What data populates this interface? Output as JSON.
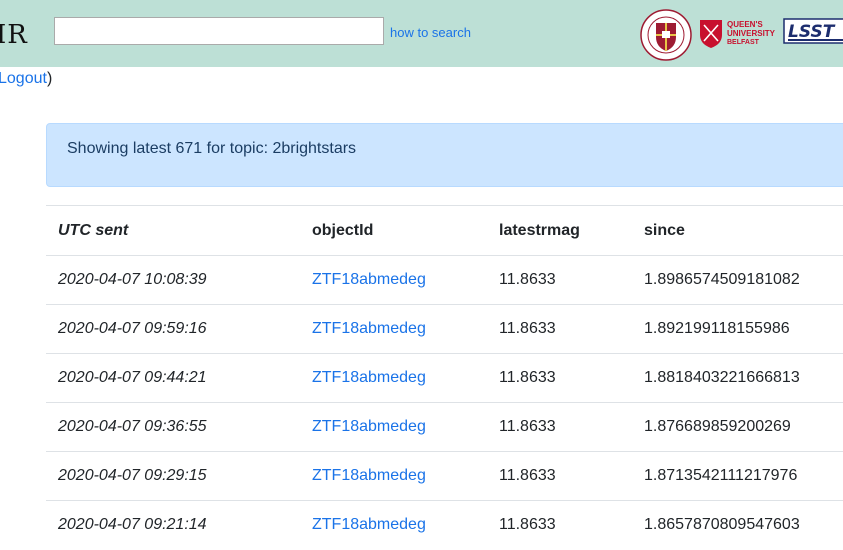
{
  "header": {
    "logo_text": "IR",
    "search": {
      "value": "",
      "placeholder": ""
    },
    "how_to_search": "how to search",
    "logos": [
      "university-of-edinburgh-logo",
      "queens-university-belfast-logo",
      "lsst-logo"
    ],
    "qub_text": [
      "QUEEN'S",
      "UNIVERSITY",
      "BELFAST"
    ],
    "lsst_text": "LSST",
    "uoe_text": "THE UNIVERSITY OF EDINBURGH"
  },
  "logout": {
    "link": "Logout",
    "suffix": ")"
  },
  "alert": {
    "text": "Showing latest 671 for topic: 2brightstars"
  },
  "table": {
    "headers": [
      "UTC sent",
      "objectId",
      "latestrmag",
      "since"
    ],
    "rows": [
      [
        "2020-04-07 10:08:39",
        "ZTF18abmedeg",
        "11.8633",
        "1.8986574509181082"
      ],
      [
        "2020-04-07 09:59:16",
        "ZTF18abmedeg",
        "11.8633",
        "1.892199118155986"
      ],
      [
        "2020-04-07 09:44:21",
        "ZTF18abmedeg",
        "11.8633",
        "1.8818403221666813"
      ],
      [
        "2020-04-07 09:36:55",
        "ZTF18abmedeg",
        "11.8633",
        "1.876689859200269"
      ],
      [
        "2020-04-07 09:29:15",
        "ZTF18abmedeg",
        "11.8633",
        "1.8713542111217976"
      ],
      [
        "2020-04-07 09:21:14",
        "ZTF18abmedeg",
        "11.8633",
        "1.8657870809547603"
      ]
    ]
  },
  "colors": {
    "header_bg": "#bde0d6",
    "link": "#1a73e8",
    "alert_bg": "#cce5ff",
    "qub_red": "#c8102e",
    "uoe_red": "#9e1b32"
  }
}
